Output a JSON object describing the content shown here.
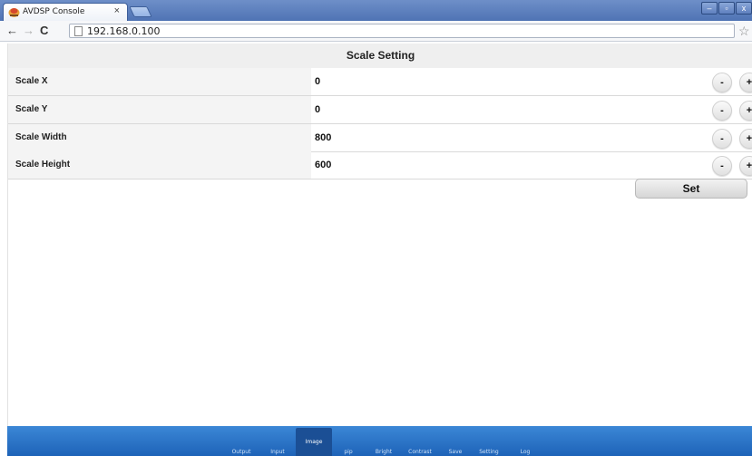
{
  "browser": {
    "tab_title": "AVDSP Console",
    "tab_close": "×",
    "url": "192.168.0.100",
    "window_controls": [
      "–",
      "▫",
      "x"
    ],
    "icons": {
      "back": "back-arrow-icon",
      "forward": "forward-arrow-icon",
      "reload": "reload-icon",
      "page": "page-icon",
      "star": "bookmark-star-icon",
      "menu": "menu-icon"
    }
  },
  "page": {
    "title": "Scale Setting",
    "rows": [
      {
        "label": "Scale X",
        "value": "0"
      },
      {
        "label": "Scale Y",
        "value": "0"
      },
      {
        "label": "Scale Width",
        "value": "800"
      },
      {
        "label": "Scale Height",
        "value": "600"
      }
    ],
    "minus_label": "-",
    "plus_label": "+",
    "set_label": "Set"
  },
  "nav": {
    "items": [
      "Output",
      "Input",
      "Image",
      "pip",
      "Bright",
      "Contrast",
      "Save",
      "Setting",
      "Log"
    ],
    "active": "Image"
  },
  "colors": {
    "nav_bg": "#2a74c8",
    "nav_active": "#1b4f95",
    "titlebar": "#5a7dbd"
  }
}
